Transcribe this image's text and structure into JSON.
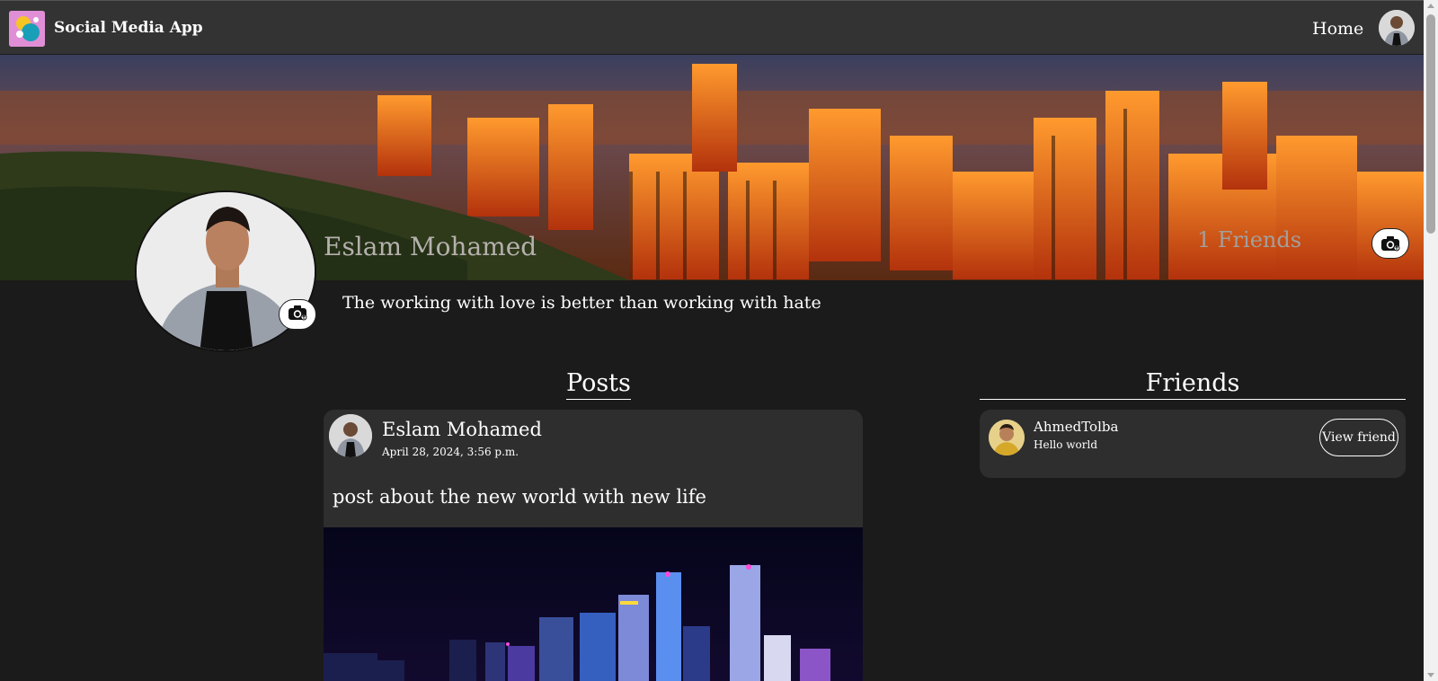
{
  "navbar": {
    "brand": "Social Media App",
    "home_label": "Home",
    "logo_icon": "app-logo-icon",
    "avatar_icon": "user-avatar"
  },
  "profile": {
    "name": "Eslam Mohamed",
    "friends_count_label": "1 Friends",
    "bio": "The working with love is better than working with hate",
    "cover_camera_icon": "camera-upload-icon",
    "profile_camera_icon": "camera-upload-icon"
  },
  "sections": {
    "posts_title": "Posts",
    "friends_title": "Friends"
  },
  "posts": [
    {
      "author": "Eslam Mohamed",
      "date": "April 28, 2024, 3:56 p.m.",
      "text": "post about the new world with new life"
    }
  ],
  "friends": [
    {
      "name": "AhmedTolba",
      "bio": "Hello world",
      "button_label": "View friend"
    }
  ],
  "colors": {
    "page_bg": "#1b1b1b",
    "navbar_bg": "#333333",
    "card_bg": "#2e2e2e"
  }
}
